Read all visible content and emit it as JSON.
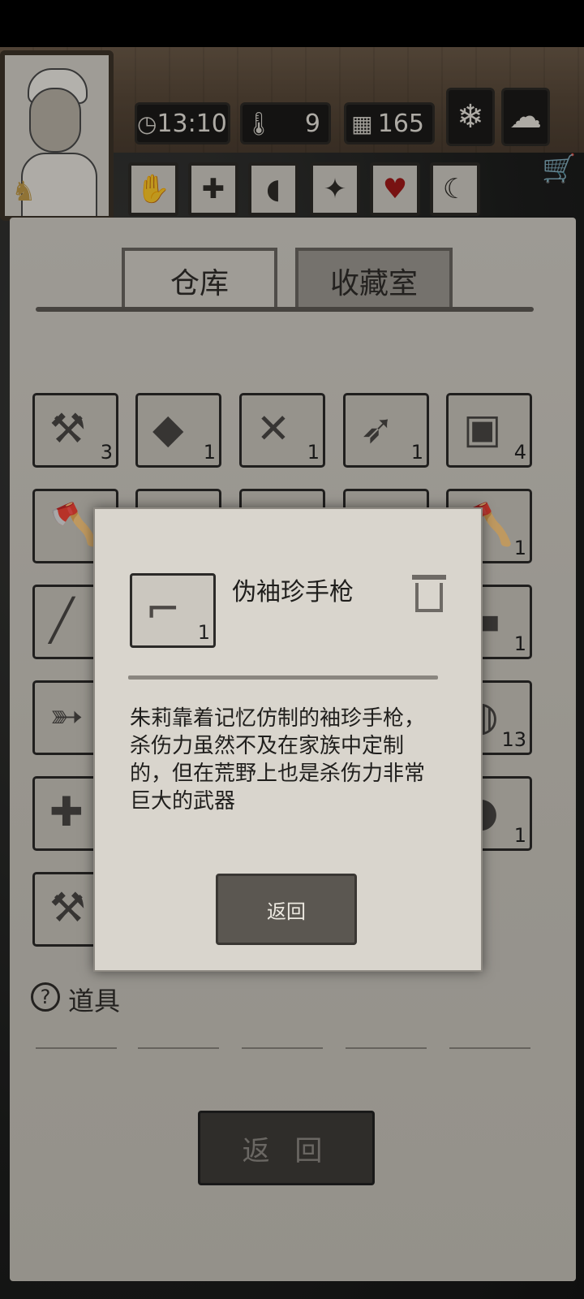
{
  "hud": {
    "time": "13:10",
    "temperature": "9",
    "day": "165",
    "icons": [
      "clock-icon",
      "thermometer-icon",
      "calendar-icon",
      "snowflake-icon",
      "cloud-icon"
    ],
    "status_buttons": [
      "hand-icon",
      "medical-cross-icon",
      "stomach-icon",
      "mind-icon",
      "heart-icon",
      "moon-icon"
    ],
    "accent_heart": "#a01818"
  },
  "tabs": [
    "仓库",
    "收藏室"
  ],
  "grid": {
    "row1_counts": [
      "3",
      "1",
      "1",
      "1",
      "4"
    ],
    "right_col_counts": [
      "1",
      "1",
      "13",
      "1"
    ]
  },
  "footer": {
    "help_symbol": "?",
    "label": "道具",
    "back_label": "返 回"
  },
  "dialog": {
    "item_count": "1",
    "title": "伪袖珍手枪",
    "description": "朱莉靠着记忆仿制的袖珍手枪，杀伤力虽然不及在家族中定制的，但在荒野上也是杀伤力非常巨大的武器",
    "back_label": "返回"
  }
}
